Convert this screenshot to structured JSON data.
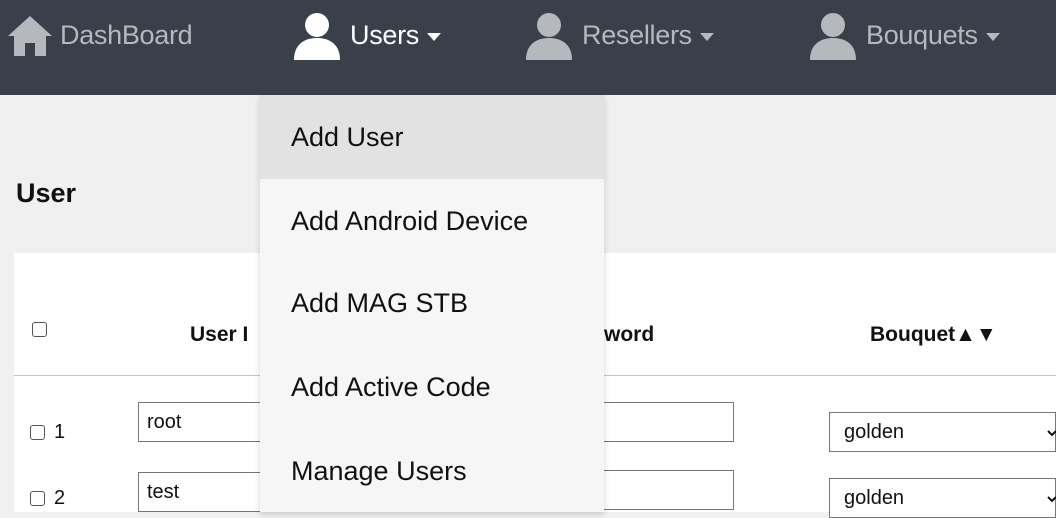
{
  "nav": {
    "dashboard": {
      "label": "DashBoard",
      "icon": "home-icon"
    },
    "users": {
      "label": "Users",
      "icon": "user-icon"
    },
    "resellers": {
      "label": "Resellers",
      "icon": "user-icon"
    },
    "bouquets": {
      "label": "Bouquets",
      "icon": "user-icon"
    }
  },
  "page": {
    "title": "User"
  },
  "table": {
    "headers": {
      "user": "User I",
      "password": "word",
      "bouquet": "Bouquet▲▼"
    },
    "rows": [
      {
        "num": "1",
        "username": "root",
        "password": "",
        "bouquet": "golden"
      },
      {
        "num": "2",
        "username": "test",
        "password": "",
        "bouquet": "golden"
      }
    ]
  },
  "users_menu": {
    "items": [
      "Add User",
      "Add Android Device",
      "Add MAG STB",
      "Add Active Code",
      "Manage Users"
    ]
  },
  "colors": {
    "topbar": "#3a4049",
    "menu_hover": "#e2e2e2",
    "header_rule": "#8fdede"
  }
}
